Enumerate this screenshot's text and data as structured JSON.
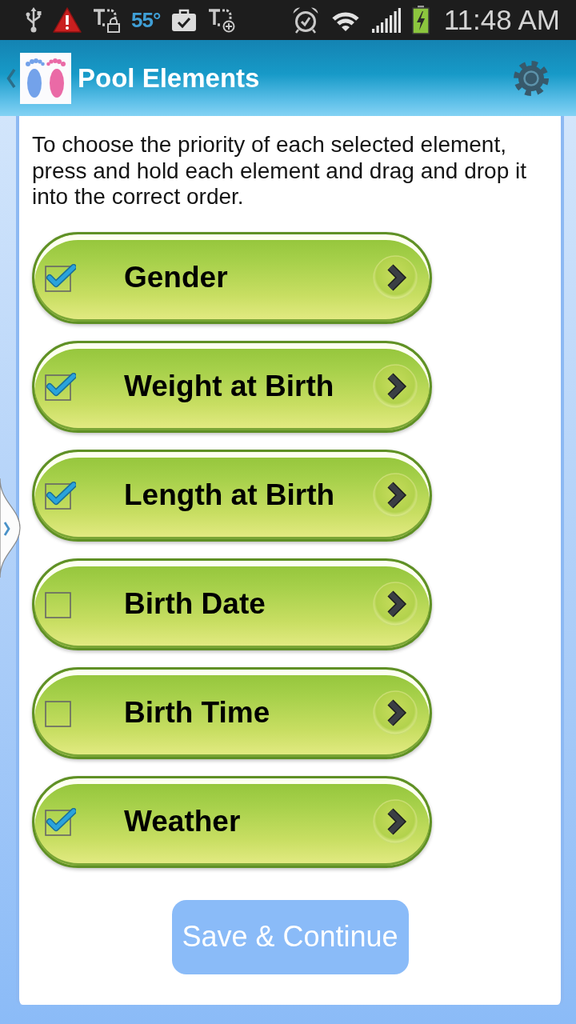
{
  "status_bar": {
    "temperature": "55°",
    "time": "11:48 AM"
  },
  "action_bar": {
    "title": "Pool Elements"
  },
  "instructions": "To choose the priority of each selected element, press and hold each element and drag and drop it into the correct order.",
  "elements": [
    {
      "label": "Gender",
      "checked": true
    },
    {
      "label": "Weight at Birth",
      "checked": true
    },
    {
      "label": "Length at Birth",
      "checked": true
    },
    {
      "label": "Birth Date",
      "checked": false
    },
    {
      "label": "Birth Time",
      "checked": false
    },
    {
      "label": "Weather",
      "checked": true
    }
  ],
  "save_button": {
    "label": "Save & Continue"
  }
}
